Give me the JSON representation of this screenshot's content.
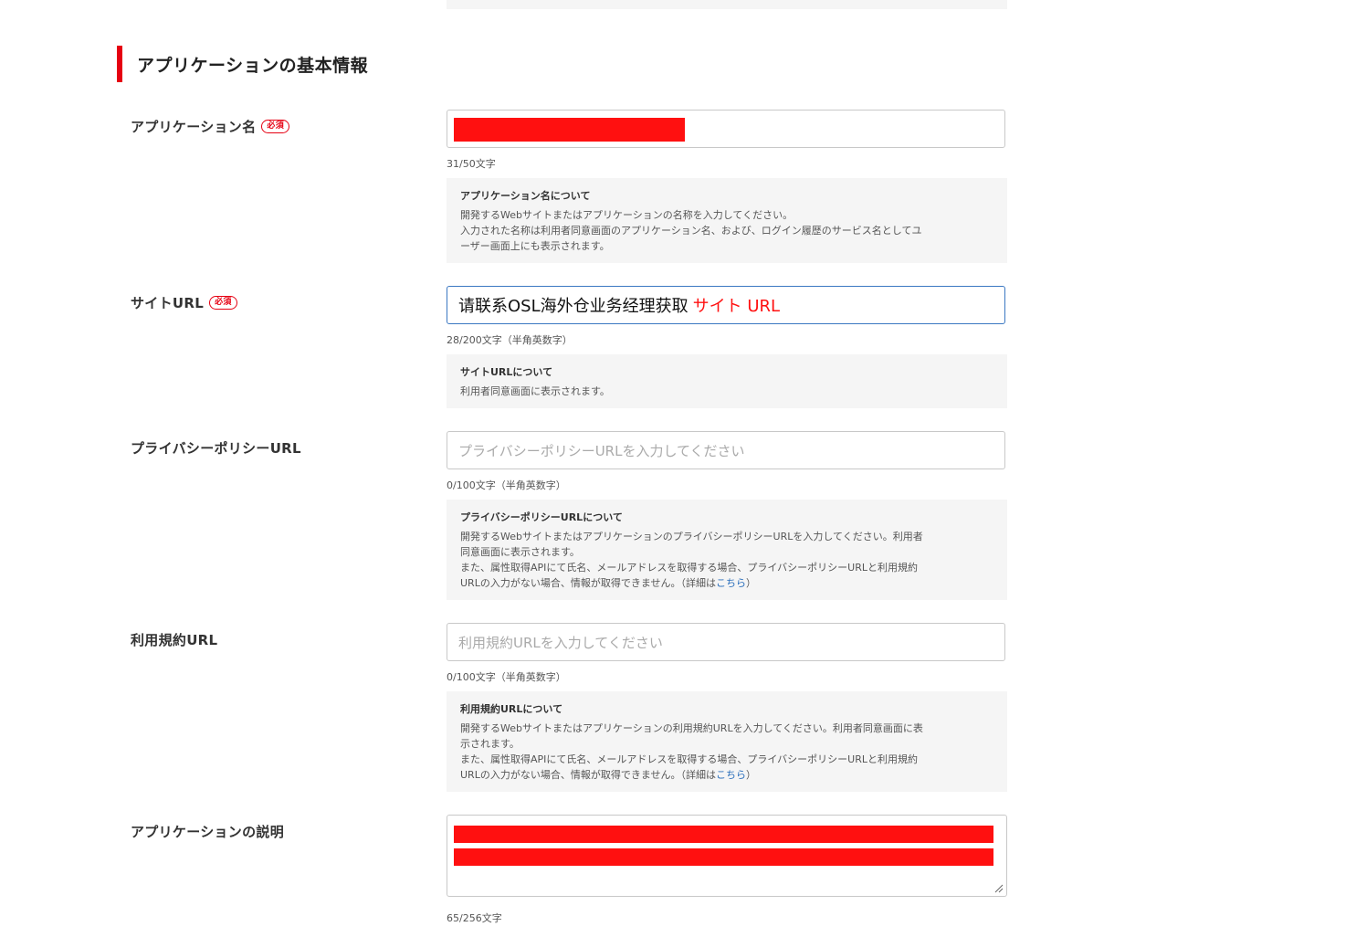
{
  "section": {
    "title": "アプリケーションの基本情報"
  },
  "required_badge": "必須",
  "app_name": {
    "label": "アプリケーション名",
    "counter": "31/50文字",
    "help_title": "アプリケーション名について",
    "help_lines": [
      "開発するWebサイトまたはアプリケーションの名称を入力してください。",
      "入力された名称は利用者同意画面のアプリケーション名、および、ログイン履歴のサービス名としてユ",
      "ーザー画面上にも表示されます。"
    ]
  },
  "site_url": {
    "label": "サイトURL",
    "value": "请联系OSL海外仓业务经理获取",
    "value_highlight": "サイト URL",
    "counter": "28/200文字（半角英数字）",
    "help_title": "サイトURLについて",
    "help_lines": [
      "利用者同意画面に表示されます。"
    ]
  },
  "privacy_url": {
    "label": "プライバシーポリシーURL",
    "placeholder": "プライバシーポリシーURLを入力してください",
    "counter": "0/100文字（半角英数字）",
    "help_title": "プライバシーポリシーURLについて",
    "help_lines": [
      "開発するWebサイトまたはアプリケーションのプライバシーポリシーURLを入力してください。利用者",
      "同意画面に表示されます。",
      "また、属性取得APIにて氏名、メールアドレスを取得する場合、プライバシーポリシーURLと利用規約"
    ],
    "help_last_prefix": "URLの入力がない場合、情報が取得できません。（詳細は",
    "help_link": "こちら",
    "help_last_suffix": "）"
  },
  "terms_url": {
    "label": "利用規約URL",
    "placeholder": "利用規約URLを入力してください",
    "counter": "0/100文字（半角英数字）",
    "help_title": "利用規約URLについて",
    "help_lines": [
      "開発するWebサイトまたはアプリケーションの利用規約URLを入力してください。利用者同意画面に表",
      "示されます。",
      "また、属性取得APIにて氏名、メールアドレスを取得する場合、プライバシーポリシーURLと利用規約"
    ],
    "help_last_prefix": "URLの入力がない場合、情報が取得できません。（詳細は",
    "help_link": "こちら",
    "help_last_suffix": "）"
  },
  "description": {
    "label": "アプリケーションの説明",
    "counter": "65/256文字"
  },
  "colors": {
    "accent": "#e60012",
    "redaction": "#ff1010",
    "link": "#2a6ebb",
    "focus_border": "#3b78c2"
  }
}
